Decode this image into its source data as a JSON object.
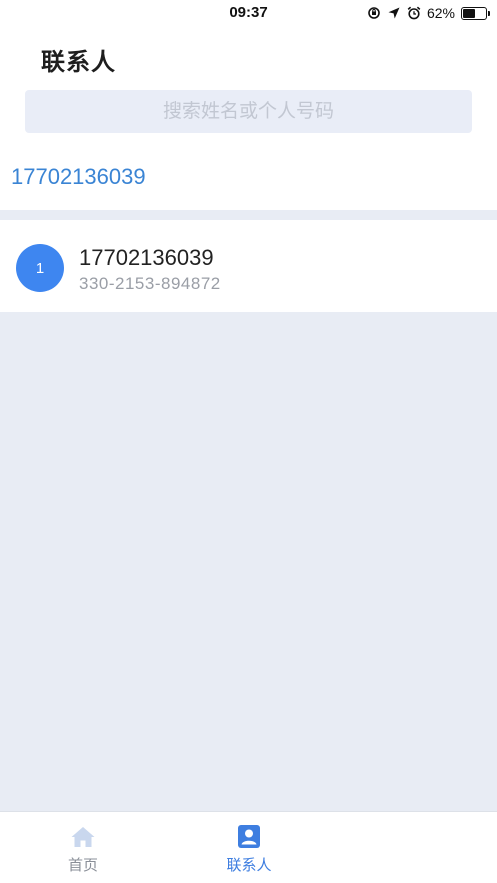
{
  "status_bar": {
    "time": "09:37",
    "battery_percent": "62%",
    "battery_level": 0.62,
    "icons": [
      "orientation-lock-icon",
      "location-icon",
      "alarm-icon",
      "battery-icon"
    ]
  },
  "header": {
    "title": "联系人",
    "search_placeholder": "搜索姓名或个人号码",
    "quick_number": "17702136039"
  },
  "contacts": [
    {
      "avatar_text": "1",
      "name": "17702136039",
      "subtitle": "330-2153-894872",
      "avatar_color": "#3e86f0"
    }
  ],
  "tab_bar": {
    "tabs": [
      {
        "label": "首页",
        "icon": "home-icon",
        "active": false
      },
      {
        "label": "联系人",
        "icon": "contact-card-icon",
        "active": true
      }
    ],
    "active_color": "#3e7ee0",
    "inactive_color": "#8a8f98"
  },
  "colors": {
    "background": "#e8ecf4",
    "accent": "#3a84d4"
  }
}
